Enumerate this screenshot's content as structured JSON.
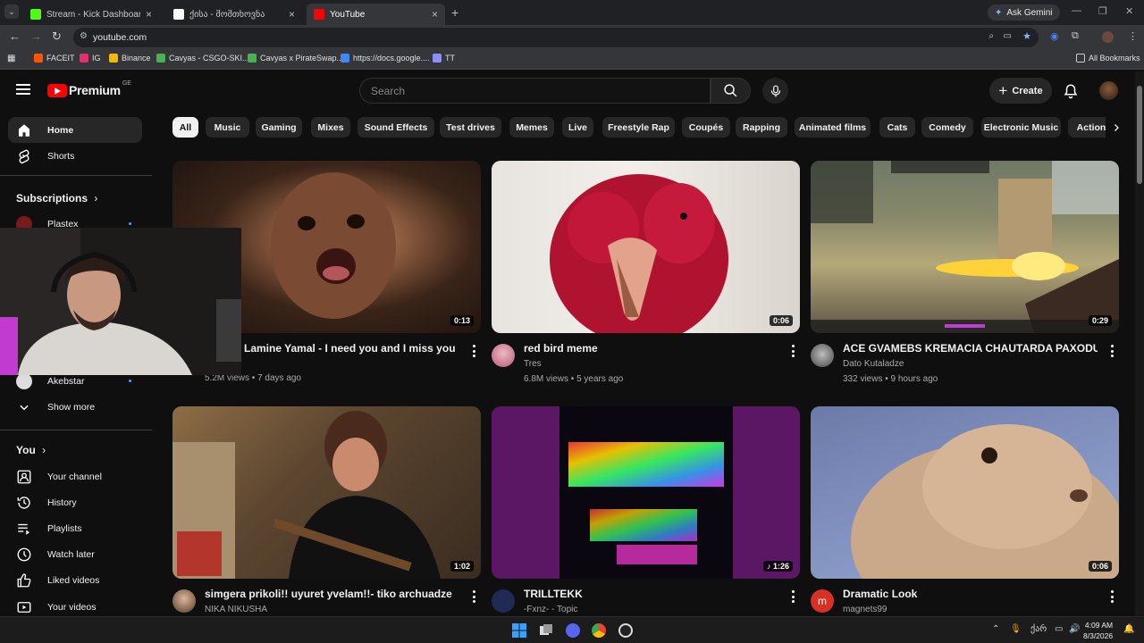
{
  "browser": {
    "tabs": [
      {
        "title": "Stream - Kick Dashboard",
        "color": "#53fc18",
        "active": false
      },
      {
        "title": "ქისა - მომთხოვნა",
        "color": "#ffffff",
        "active": false
      },
      {
        "title": "YouTube",
        "color": "#ff0000",
        "active": true
      }
    ],
    "new_tab": "+",
    "ask_gemini": "Ask Gemini",
    "url": "youtube.com",
    "bookmarks": [
      {
        "label": "FACEIT",
        "color": "#ff5500"
      },
      {
        "label": "IG",
        "color": "#e1306c"
      },
      {
        "label": "Binance",
        "color": "#f0b90b"
      },
      {
        "label": "Cavyas - CSGO-SKI...",
        "color": "#4caf50"
      },
      {
        "label": "Cavyas x PirateSwap...",
        "color": "#4caf50"
      },
      {
        "label": "https://docs.google....",
        "color": "#4285f4"
      },
      {
        "label": "TT",
        "color": "#8e8eff"
      }
    ],
    "all_bookmarks": "All Bookmarks"
  },
  "masthead": {
    "logo_text": "Premium",
    "country_code": "GE",
    "search_placeholder": "Search",
    "create_label": "Create"
  },
  "sidebar": {
    "items_top": [
      {
        "label": "Home",
        "icon": "home-icon",
        "active": true
      },
      {
        "label": "Shorts",
        "icon": "shorts-icon",
        "active": false
      }
    ],
    "subscriptions_heading": "Subscriptions",
    "subscriptions": [
      {
        "label": "Plastex"
      },
      {
        "label": "Akebstar"
      }
    ],
    "show_more": "Show more",
    "you_heading": "You",
    "you_items": [
      {
        "label": "Your channel",
        "icon": "channel-icon"
      },
      {
        "label": "History",
        "icon": "history-icon"
      },
      {
        "label": "Playlists",
        "icon": "playlists-icon"
      },
      {
        "label": "Watch later",
        "icon": "watch-later-icon"
      },
      {
        "label": "Liked videos",
        "icon": "liked-icon"
      },
      {
        "label": "Your videos",
        "icon": "your-videos-icon"
      }
    ]
  },
  "chips": [
    "All",
    "Music",
    "Gaming",
    "Mixes",
    "Sound Effects",
    "Test drives",
    "Memes",
    "Live",
    "Freestyle Rap",
    "Coupés",
    "Rapping",
    "Animated films",
    "Cats",
    "Comedy",
    "Electronic Music",
    "Action"
  ],
  "videos": [
    {
      "title": "Lamine Yamal - I need you and I miss you",
      "channel": "",
      "meta": "5.2M views • 7 days ago",
      "duration": "0:13"
    },
    {
      "title": "red bird meme",
      "channel": "Tres",
      "meta": "6.8M views • 5 years ago",
      "duration": "0:06"
    },
    {
      "title": "ACE  GVAMEBS KREMACIA CHAUTARDA PAXODU",
      "channel": "Dato Kutaladze",
      "meta": "332 views • 9 hours ago",
      "duration": "0:29"
    },
    {
      "title": "simgera prikoli!! uyuret yvelam!!- tiko archuadze",
      "channel": "NIKA NIKUSHA",
      "meta": "",
      "duration": "1:02"
    },
    {
      "title": "TRILLTEKK",
      "channel": "-Fxnz- - Topic",
      "meta": "",
      "duration": "1:26",
      "music": true
    },
    {
      "title": "Dramatic Look",
      "channel": "magnets99",
      "meta": "",
      "duration": "0:06",
      "avatar_letter": "m"
    }
  ],
  "taskbar": {
    "lang": "ქარ",
    "time": "4:09 AM",
    "date": "8/3/2026"
  }
}
